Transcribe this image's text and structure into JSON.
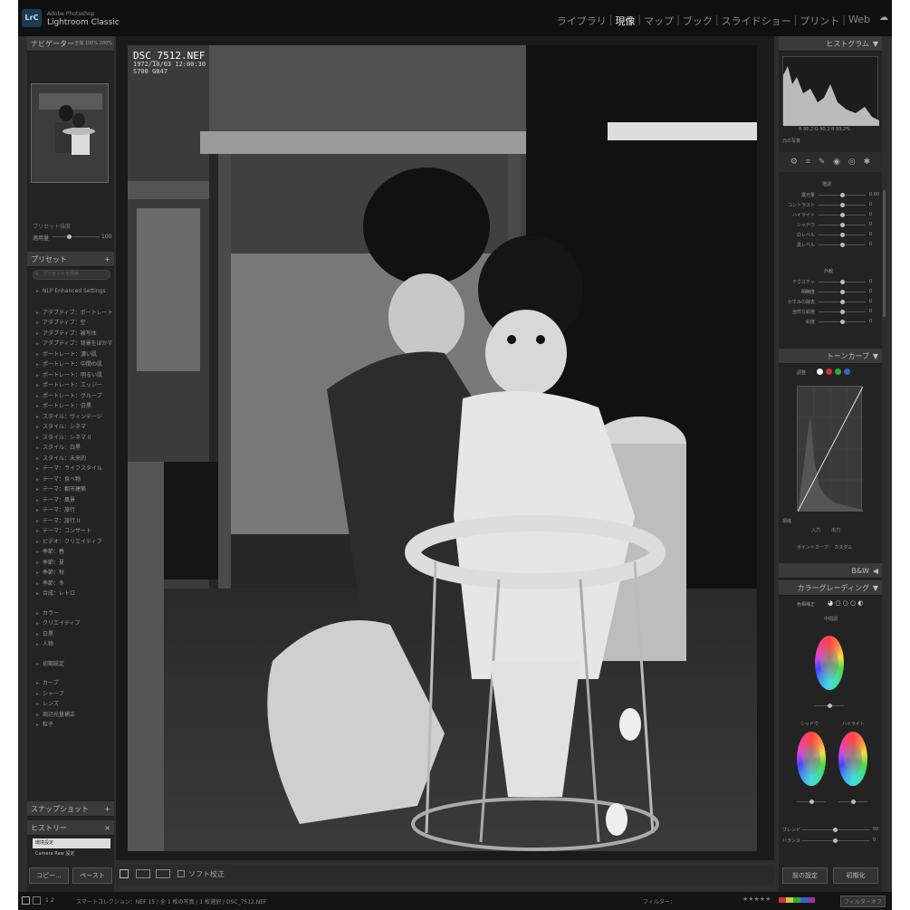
{
  "app": {
    "logo": "LrC",
    "brand_line1": "Adobe Photoshop",
    "brand_line2": "Lightroom Classic"
  },
  "modules": [
    {
      "label": "ライブラリ",
      "active": false
    },
    {
      "label": "現像",
      "active": true
    },
    {
      "label": "マップ",
      "active": false
    },
    {
      "label": "ブック",
      "active": false
    },
    {
      "label": "スライドショー",
      "active": false
    },
    {
      "label": "プリント",
      "active": false
    },
    {
      "label": "Web",
      "active": false
    }
  ],
  "left": {
    "navigator": {
      "title": "ナビゲーター",
      "zoom_fit": "全体",
      "zoom_100": "100%",
      "zoom_200": "200%"
    },
    "preset_amount": {
      "label": "プリセット強度",
      "slider_label": "適用量",
      "value": "100"
    },
    "presets": {
      "title": "プリセット",
      "search_placeholder": "プリセットを検索",
      "groups": [
        [
          "NLP Enhanced Settings"
        ],
        [
          "アダプティブ：ポートレート",
          "アダプティブ：空",
          "アダプティブ：被写体",
          "アダプティブ：背景をぼかす",
          "ポートレート：濃い肌",
          "ポートレート：中間の肌",
          "ポートレート：明るい肌",
          "ポートレート：エッジー",
          "ポートレート：グループ",
          "ポートレート：白黒",
          "スタイル：ヴィンテージ",
          "スタイル：シネマ",
          "スタイル：シネマ II",
          "スタイル：白黒",
          "スタイル：未来的",
          "テーマ：ライフスタイル",
          "テーマ：食べ物",
          "テーマ：都市建築",
          "テーマ：風景",
          "テーマ：旅行",
          "テーマ：旅行 II",
          "テーマ：コンサート",
          "ビデオ：クリエイティブ",
          "季節：春",
          "季節：夏",
          "季節：秋",
          "季節：冬",
          "合成：レトロ"
        ],
        [
          "カラー",
          "クリエイティブ",
          "白黒",
          "人物"
        ],
        [
          "初期設定"
        ],
        [
          "カーブ",
          "シャープ",
          "レンズ",
          "周辺光量補正",
          "粒子"
        ]
      ]
    },
    "snapshot": {
      "title": "スナップショット"
    },
    "history": {
      "title": "ヒストリー",
      "items": [
        "環境設定",
        "Camera Raw 設定"
      ]
    },
    "copy_label": "コピー...",
    "paste_label": "ペースト"
  },
  "photo": {
    "filename": "DSC_7512.NEF",
    "datetime": "1972/10/03 12:00:30",
    "camera": "S700 G847"
  },
  "toolbar": {
    "soft_proof": "ソフト校正"
  },
  "right": {
    "histogram": {
      "title": "ヒストグラム",
      "readout": "R  90.2  G  90.2  B  93.2%",
      "orig_label": "元の写真"
    },
    "basic": {
      "section": "階調",
      "sliders": [
        {
          "label": "露光量",
          "value": "0.00",
          "pos": 0.5
        },
        {
          "label": "コントラスト",
          "value": "0",
          "pos": 0.5
        },
        {
          "label": "ハイライト",
          "value": "0",
          "pos": 0.5
        },
        {
          "label": "シャドウ",
          "value": "0",
          "pos": 0.5
        },
        {
          "label": "白レベル",
          "value": "0",
          "pos": 0.5
        },
        {
          "label": "黒レベル",
          "value": "0",
          "pos": 0.5
        }
      ],
      "presence": "外観",
      "presence_sliders": [
        {
          "label": "テクスチャ",
          "value": "0",
          "pos": 0.5
        },
        {
          "label": "明瞭度",
          "value": "0",
          "pos": 0.5
        },
        {
          "label": "かすみの除去",
          "value": "0",
          "pos": 0.5
        },
        {
          "label": "自然な彩度",
          "value": "0",
          "pos": 0.5
        },
        {
          "label": "彩度",
          "value": "0",
          "pos": 0.5
        }
      ]
    },
    "tone_curve": {
      "title": "トーンカーブ",
      "channel_label": "調整",
      "region_label": "領域",
      "point_curve": "ポイントカーブ：",
      "point_curve_value": "カスタム",
      "input_label": "入力",
      "output_label": "出力"
    },
    "bw": {
      "title": "B&W"
    },
    "color_grading": {
      "title": "カラーグレーディング",
      "adjust_label": "色相補正",
      "midtones": "中間調",
      "shadows": "シャドウ",
      "highlights": "ハイライト",
      "blending_label": "ブレンド",
      "blending_value": "50",
      "balance_label": "バランス",
      "balance_value": "0"
    },
    "prev_button": "前の設定",
    "reset_button": "初期化"
  },
  "filmstrip": {
    "pages": "1  2",
    "path": "スマートコレクション：NEF  15 / 全 1 枚の写真 / 1 枚選択 / DSC_7512.NEF",
    "filter_label": "フィルター：",
    "filter_off": "フィルターオフ"
  },
  "colors": {
    "bg": "#2e2e2e",
    "panel": "#232323",
    "header": "#3a3a3a",
    "accent": "#eeeeee"
  }
}
